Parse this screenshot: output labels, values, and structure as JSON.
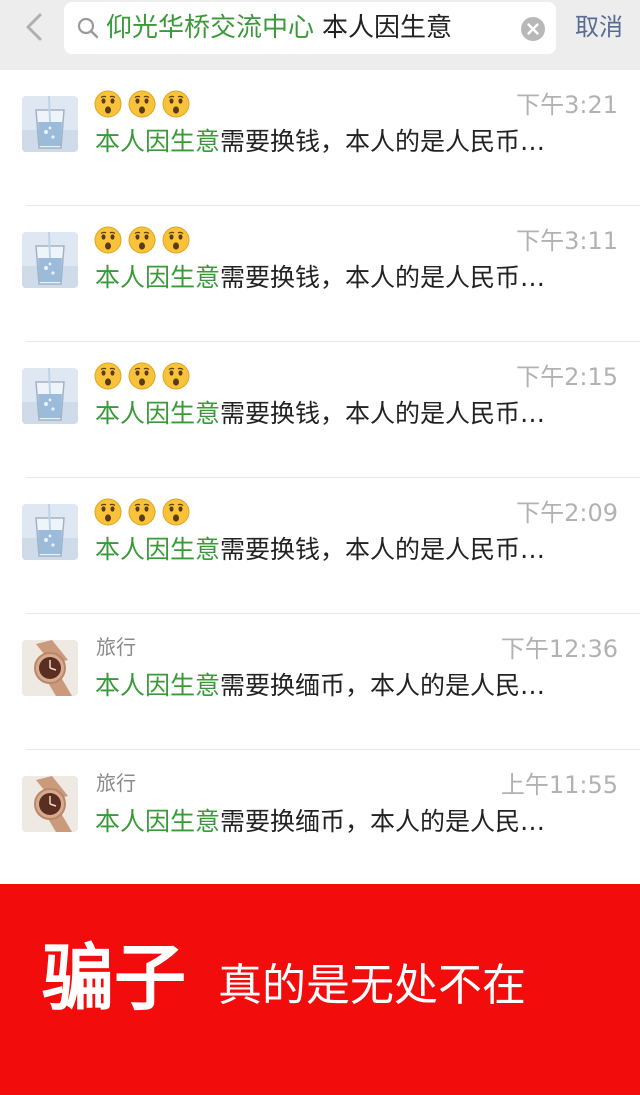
{
  "search": {
    "group_name": "仰光华桥交流中心",
    "query": "本人因生意",
    "cancel_label": "取消"
  },
  "results": [
    {
      "name": "",
      "emoji_count": 3,
      "time": "下午3:21",
      "highlight": "本人因生意",
      "rest": "需要换钱，本人的是人民币…",
      "avatar": "water-glass"
    },
    {
      "name": "",
      "emoji_count": 3,
      "time": "下午3:11",
      "highlight": "本人因生意",
      "rest": "需要换钱，本人的是人民币…",
      "avatar": "water-glass"
    },
    {
      "name": "",
      "emoji_count": 3,
      "time": "下午2:15",
      "highlight": "本人因生意",
      "rest": "需要换钱，本人的是人民币…",
      "avatar": "water-glass"
    },
    {
      "name": "",
      "emoji_count": 3,
      "time": "下午2:09",
      "highlight": "本人因生意",
      "rest": "需要换钱，本人的是人民币…",
      "avatar": "water-glass"
    },
    {
      "name": "旅行",
      "emoji_count": 0,
      "time": "下午12:36",
      "highlight": "本人因生意",
      "rest": "需要换缅币，本人的是人民…",
      "avatar": "watch"
    },
    {
      "name": "旅行",
      "emoji_count": 0,
      "time": "上午11:55",
      "highlight": "本人因生意",
      "rest": "需要换缅币，本人的是人民…",
      "avatar": "watch"
    }
  ],
  "banner": {
    "big": "骗子",
    "small": "真的是无处不在",
    "color": "#f20c0c"
  },
  "colors": {
    "highlight": "#3a9a3a",
    "link": "#576b95",
    "time": "#b2b2b2"
  }
}
